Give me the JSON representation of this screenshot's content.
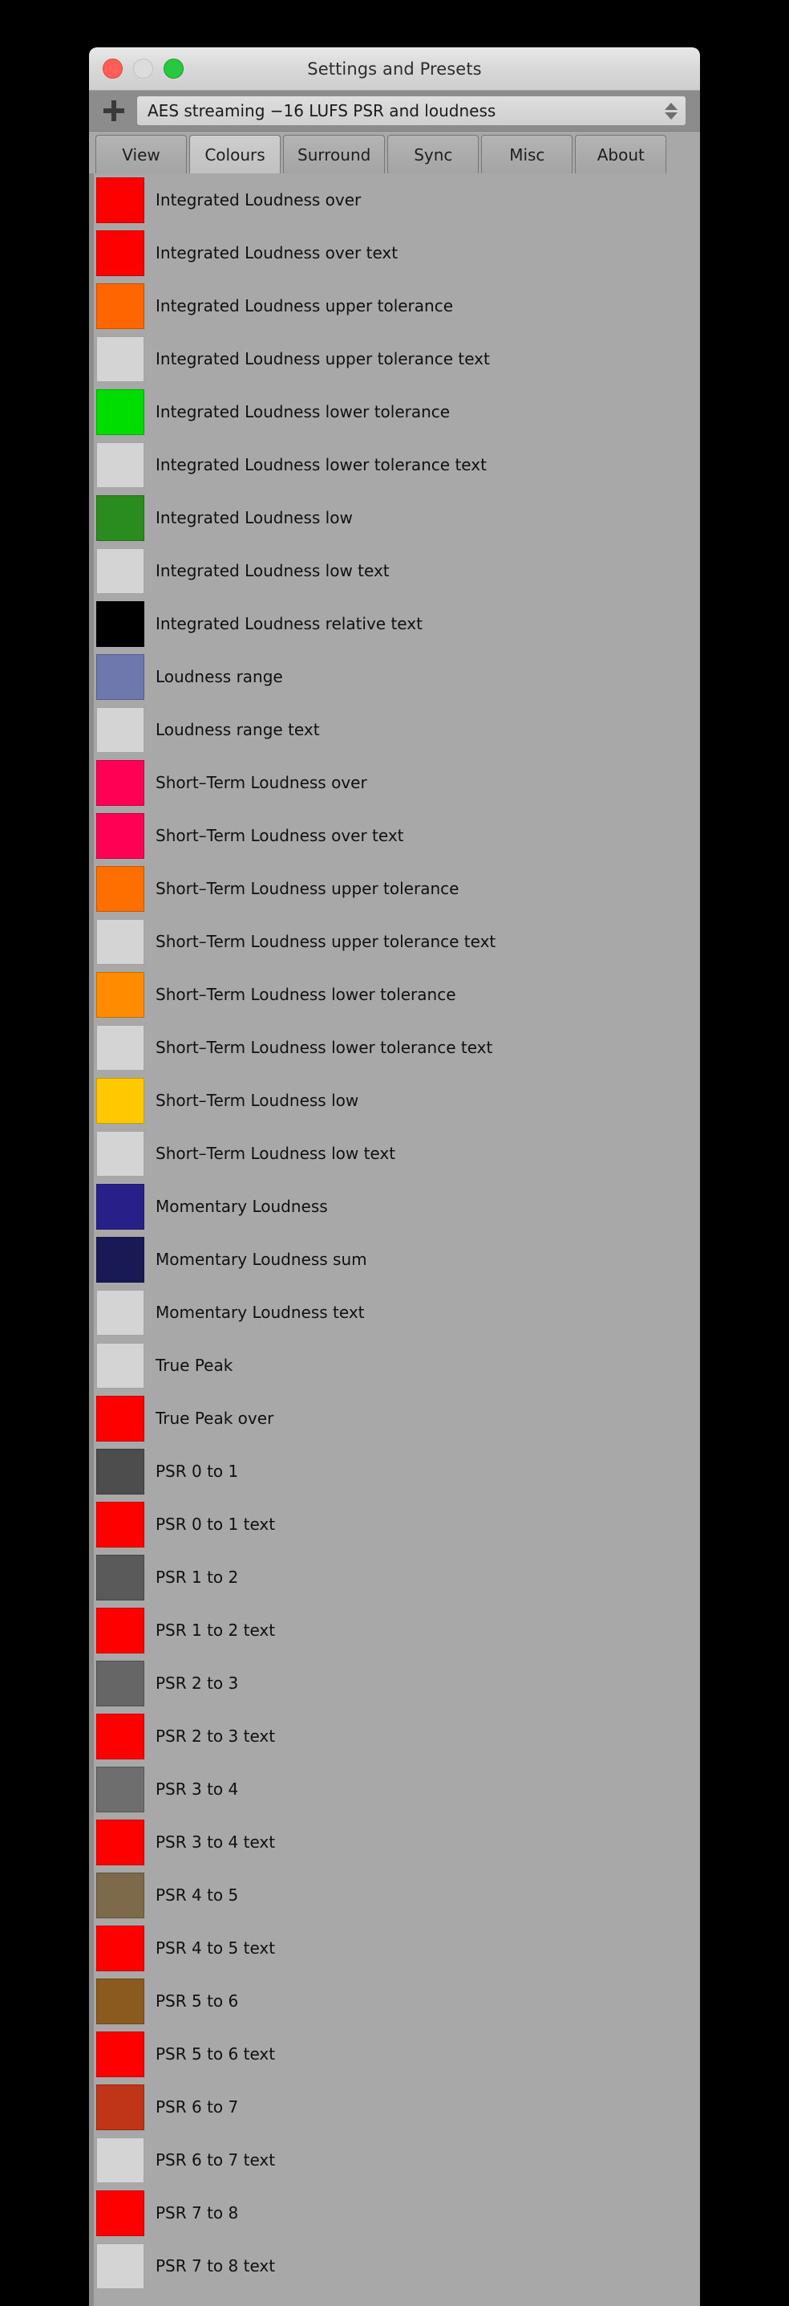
{
  "window": {
    "title": "Settings and Presets",
    "traffic_lights": [
      {
        "name": "close",
        "color": "#ff5f57"
      },
      {
        "name": "minimize",
        "color": "#dcdcdc"
      },
      {
        "name": "zoom",
        "color": "#28c840"
      }
    ]
  },
  "preset_bar": {
    "add_button_icon": "plus-icon",
    "selected_preset": "AES streaming −16 LUFS PSR and loudness",
    "stepper_icon": "up-down-stepper-icon"
  },
  "tabs": [
    {
      "label": "View",
      "active": false
    },
    {
      "label": "Colours",
      "active": true
    },
    {
      "label": "Surround",
      "active": false
    },
    {
      "label": "Sync",
      "active": false
    },
    {
      "label": "Misc",
      "active": false
    },
    {
      "label": "About",
      "active": false
    }
  ],
  "colour_rows": [
    {
      "label": "Integrated Loudness over",
      "color": "#ff0000"
    },
    {
      "label": "Integrated Loudness over text",
      "color": "#ff0000"
    },
    {
      "label": "Integrated Loudness upper tolerance",
      "color": "#ff6600"
    },
    {
      "label": "Integrated Loudness upper tolerance text",
      "color": "#d4d4d4"
    },
    {
      "label": "Integrated Loudness lower tolerance",
      "color": "#00dd00"
    },
    {
      "label": "Integrated Loudness lower tolerance text",
      "color": "#d4d4d4"
    },
    {
      "label": "Integrated Loudness low",
      "color": "#2a8b1e"
    },
    {
      "label": "Integrated Loudness low text",
      "color": "#d4d4d4"
    },
    {
      "label": "Integrated Loudness relative text",
      "color": "#000000"
    },
    {
      "label": "Loudness range",
      "color": "#6f78ac"
    },
    {
      "label": "Loudness range text",
      "color": "#d4d4d4"
    },
    {
      "label": "Short–Term Loudness over",
      "color": "#ff0055"
    },
    {
      "label": "Short–Term Loudness over text",
      "color": "#ff0055"
    },
    {
      "label": "Short–Term Loudness upper tolerance",
      "color": "#ff6f00"
    },
    {
      "label": "Short–Term Loudness upper tolerance text",
      "color": "#d4d4d4"
    },
    {
      "label": "Short–Term Loudness lower tolerance",
      "color": "#ff8c00"
    },
    {
      "label": "Short–Term Loudness lower tolerance text",
      "color": "#d4d4d4"
    },
    {
      "label": "Short–Term Loudness low",
      "color": "#ffc800"
    },
    {
      "label": "Short–Term Loudness low text",
      "color": "#d4d4d4"
    },
    {
      "label": "Momentary Loudness",
      "color": "#262088"
    },
    {
      "label": "Momentary Loudness sum",
      "color": "#191a55"
    },
    {
      "label": "Momentary Loudness text",
      "color": "#d4d4d4"
    },
    {
      "label": "True Peak",
      "color": "#d4d4d4"
    },
    {
      "label": "True Peak over",
      "color": "#ff0000"
    },
    {
      "label": "PSR 0 to 1",
      "color": "#4d4d4d"
    },
    {
      "label": "PSR 0 to 1 text",
      "color": "#ff0000"
    },
    {
      "label": "PSR 1 to 2",
      "color": "#5a5a5a"
    },
    {
      "label": "PSR 1 to 2 text",
      "color": "#ff0000"
    },
    {
      "label": "PSR 2 to 3",
      "color": "#666666"
    },
    {
      "label": "PSR 2 to 3 text",
      "color": "#ff0000"
    },
    {
      "label": "PSR 3 to 4",
      "color": "#6e6e6e"
    },
    {
      "label": "PSR 3 to 4 text",
      "color": "#ff0000"
    },
    {
      "label": "PSR 4 to 5",
      "color": "#7d6a4a"
    },
    {
      "label": "PSR 4 to 5 text",
      "color": "#ff0000"
    },
    {
      "label": "PSR 5 to 6",
      "color": "#8b5a1e"
    },
    {
      "label": "PSR 5 to 6 text",
      "color": "#ff0000"
    },
    {
      "label": "PSR 6 to 7",
      "color": "#c03418"
    },
    {
      "label": "PSR 6 to 7 text",
      "color": "#d4d4d4"
    },
    {
      "label": "PSR 7 to 8",
      "color": "#ff0000"
    },
    {
      "label": "PSR 7 to 8 text",
      "color": "#d4d4d4"
    }
  ]
}
